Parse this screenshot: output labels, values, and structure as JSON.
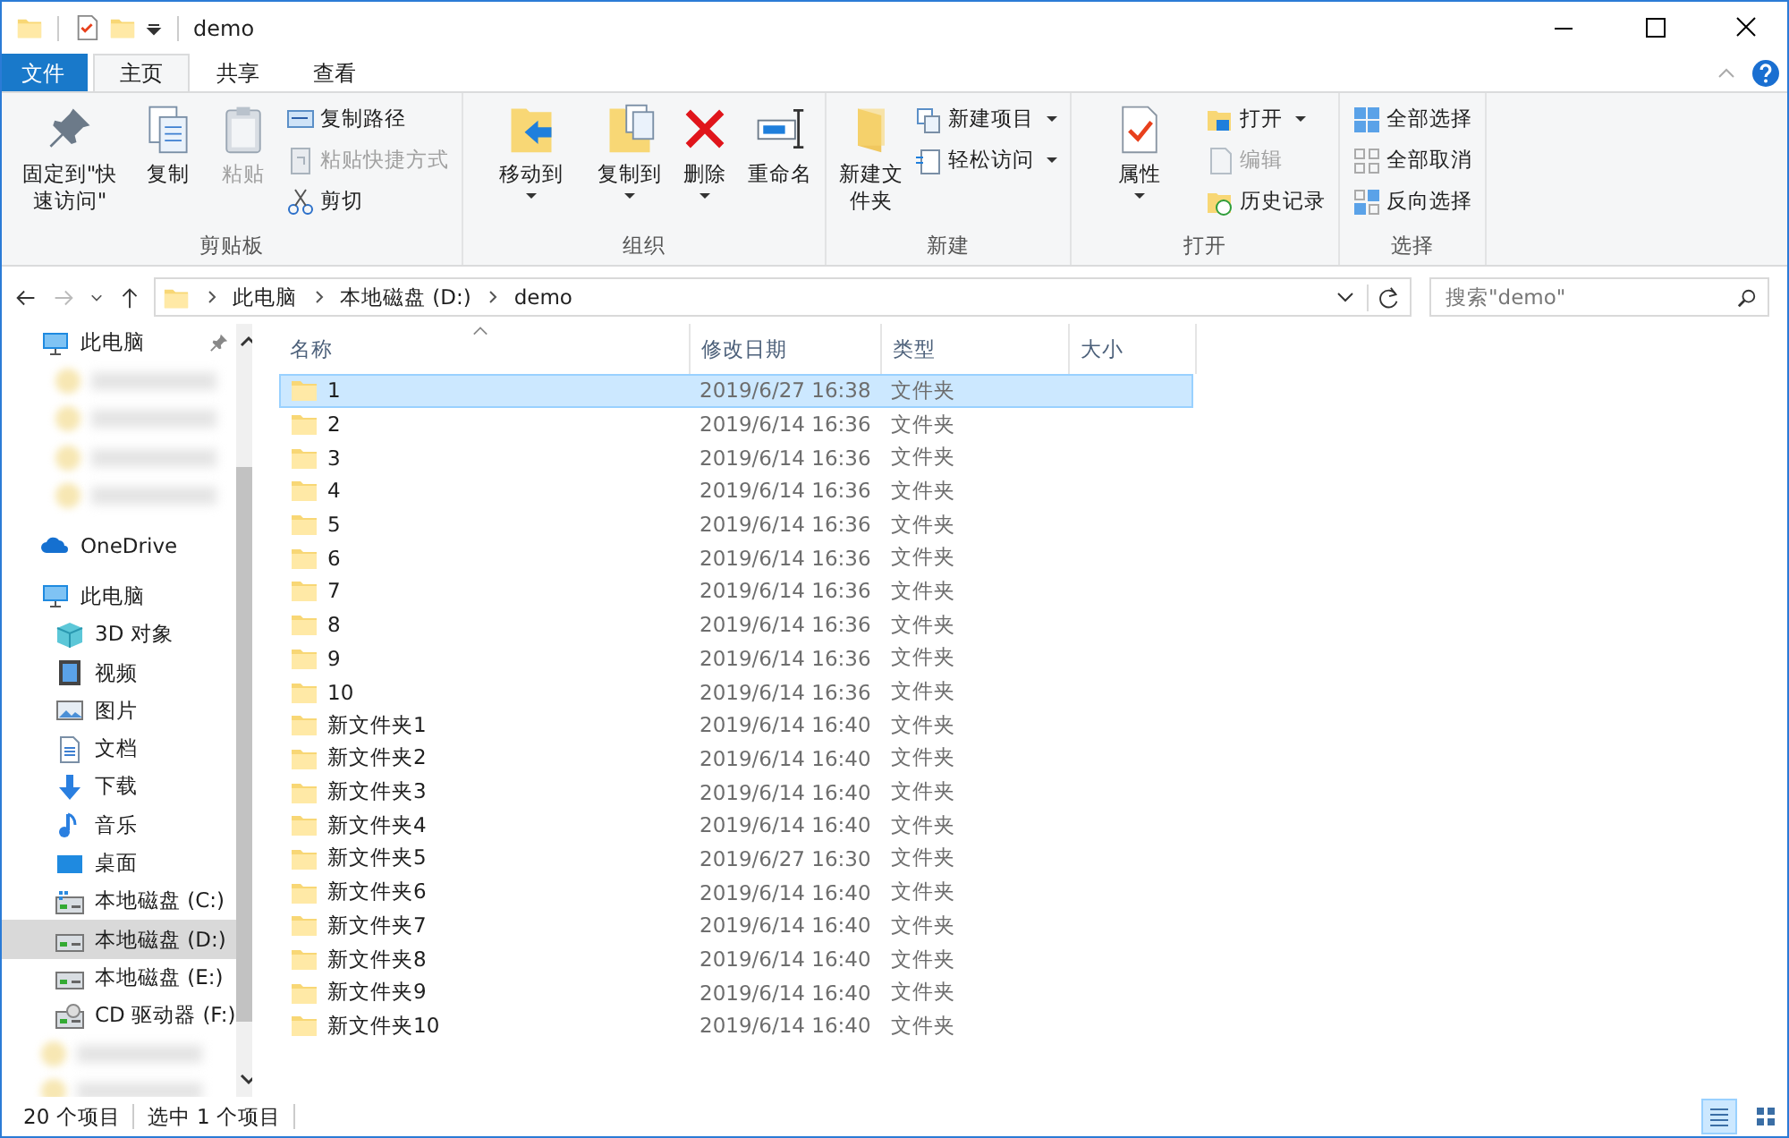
{
  "window": {
    "title": "demo"
  },
  "ribbon_tabs": [
    {
      "label": "文件",
      "kind": "file",
      "selected": false
    },
    {
      "label": "主页",
      "kind": "tab",
      "selected": true
    },
    {
      "label": "共享",
      "kind": "tab",
      "selected": false
    },
    {
      "label": "查看",
      "kind": "tab",
      "selected": false
    }
  ],
  "ribbon_groups": [
    {
      "label": "剪贴板",
      "items": [
        {
          "label": "固定到\"快速访问\"",
          "kind": "large",
          "disabled": false,
          "dropdown": false
        },
        {
          "label": "复制",
          "kind": "large",
          "disabled": false,
          "dropdown": false
        },
        {
          "label": "粘贴",
          "kind": "large",
          "disabled": true,
          "dropdown": false
        },
        {
          "label": "复制路径",
          "kind": "small",
          "disabled": false,
          "dropdown": false
        },
        {
          "label": "粘贴快捷方式",
          "kind": "small",
          "disabled": true,
          "dropdown": false
        },
        {
          "label": "剪切",
          "kind": "small",
          "disabled": false,
          "dropdown": false
        }
      ]
    },
    {
      "label": "组织",
      "items": [
        {
          "label": "移动到",
          "kind": "large",
          "disabled": false,
          "dropdown": true
        },
        {
          "label": "复制到",
          "kind": "large",
          "disabled": false,
          "dropdown": true
        },
        {
          "label": "删除",
          "kind": "large",
          "disabled": false,
          "dropdown": true
        },
        {
          "label": "重命名",
          "kind": "large",
          "disabled": false,
          "dropdown": false
        }
      ]
    },
    {
      "label": "新建",
      "items": [
        {
          "label": "新建文件夹",
          "kind": "large",
          "disabled": false,
          "dropdown": false
        },
        {
          "label": "新建项目",
          "kind": "small",
          "disabled": false,
          "dropdown": true
        },
        {
          "label": "轻松访问",
          "kind": "small",
          "disabled": false,
          "dropdown": true
        }
      ]
    },
    {
      "label": "打开",
      "items": [
        {
          "label": "属性",
          "kind": "large",
          "disabled": false,
          "dropdown": true
        },
        {
          "label": "打开",
          "kind": "small",
          "disabled": false,
          "dropdown": true
        },
        {
          "label": "编辑",
          "kind": "small",
          "disabled": true,
          "dropdown": false
        },
        {
          "label": "历史记录",
          "kind": "small",
          "disabled": false,
          "dropdown": false
        }
      ]
    },
    {
      "label": "选择",
      "items": [
        {
          "label": "全部选择",
          "kind": "small",
          "disabled": false,
          "dropdown": false
        },
        {
          "label": "全部取消",
          "kind": "small",
          "disabled": false,
          "dropdown": false
        },
        {
          "label": "反向选择",
          "kind": "small",
          "disabled": false,
          "dropdown": false
        }
      ]
    }
  ],
  "address": {
    "crumbs": [
      "此电脑",
      "本地磁盘 (D:)",
      "demo"
    ],
    "search_placeholder": "搜索\"demo\""
  },
  "navigation": [
    {
      "label": "此电脑",
      "kind": "item",
      "selected": false,
      "pinned": true,
      "children": [
        {
          "kind": "blurred",
          "selected": false
        },
        {
          "kind": "blurred",
          "selected": false
        },
        {
          "kind": "blurred",
          "selected": false
        },
        {
          "kind": "blurred",
          "selected": false
        }
      ]
    },
    {
      "label": "OneDrive",
      "kind": "item",
      "selected": false,
      "pinned": false
    },
    {
      "label": "此电脑",
      "kind": "item",
      "selected": false,
      "pinned": false,
      "children": [
        {
          "label": "3D 对象",
          "kind": "item",
          "selected": false
        },
        {
          "label": "视频",
          "kind": "item",
          "selected": false
        },
        {
          "label": "图片",
          "kind": "item",
          "selected": false
        },
        {
          "label": "文档",
          "kind": "item",
          "selected": false
        },
        {
          "label": "下载",
          "kind": "item",
          "selected": false
        },
        {
          "label": "音乐",
          "kind": "item",
          "selected": false
        },
        {
          "label": "桌面",
          "kind": "item",
          "selected": false
        },
        {
          "label": "本地磁盘 (C:)",
          "kind": "item",
          "selected": false
        },
        {
          "label": "本地磁盘 (D:)",
          "kind": "item",
          "selected": true
        },
        {
          "label": "本地磁盘 (E:)",
          "kind": "item",
          "selected": false
        },
        {
          "label": "CD 驱动器 (F:)",
          "kind": "item",
          "selected": false
        }
      ]
    },
    {
      "kind": "blurred",
      "selected": false
    },
    {
      "kind": "blurred",
      "selected": false
    }
  ],
  "table": {
    "columns": [
      "名称",
      "修改日期",
      "类型",
      "大小"
    ],
    "rows": [
      {
        "name": "1",
        "modified": "2019/6/27 16:38",
        "type": "文件夹",
        "selected": true
      },
      {
        "name": "2",
        "modified": "2019/6/14 16:36",
        "type": "文件夹",
        "selected": false
      },
      {
        "name": "3",
        "modified": "2019/6/14 16:36",
        "type": "文件夹",
        "selected": false
      },
      {
        "name": "4",
        "modified": "2019/6/14 16:36",
        "type": "文件夹",
        "selected": false
      },
      {
        "name": "5",
        "modified": "2019/6/14 16:36",
        "type": "文件夹",
        "selected": false
      },
      {
        "name": "6",
        "modified": "2019/6/14 16:36",
        "type": "文件夹",
        "selected": false
      },
      {
        "name": "7",
        "modified": "2019/6/14 16:36",
        "type": "文件夹",
        "selected": false
      },
      {
        "name": "8",
        "modified": "2019/6/14 16:36",
        "type": "文件夹",
        "selected": false
      },
      {
        "name": "9",
        "modified": "2019/6/14 16:36",
        "type": "文件夹",
        "selected": false
      },
      {
        "name": "10",
        "modified": "2019/6/14 16:36",
        "type": "文件夹",
        "selected": false
      },
      {
        "name": "新文件夹1",
        "modified": "2019/6/14 16:40",
        "type": "文件夹",
        "selected": false
      },
      {
        "name": "新文件夹2",
        "modified": "2019/6/14 16:40",
        "type": "文件夹",
        "selected": false
      },
      {
        "name": "新文件夹3",
        "modified": "2019/6/14 16:40",
        "type": "文件夹",
        "selected": false
      },
      {
        "name": "新文件夹4",
        "modified": "2019/6/14 16:40",
        "type": "文件夹",
        "selected": false
      },
      {
        "name": "新文件夹5",
        "modified": "2019/6/27 16:30",
        "type": "文件夹",
        "selected": false
      },
      {
        "name": "新文件夹6",
        "modified": "2019/6/14 16:40",
        "type": "文件夹",
        "selected": false
      },
      {
        "name": "新文件夹7",
        "modified": "2019/6/14 16:40",
        "type": "文件夹",
        "selected": false
      },
      {
        "name": "新文件夹8",
        "modified": "2019/6/14 16:40",
        "type": "文件夹",
        "selected": false
      },
      {
        "name": "新文件夹9",
        "modified": "2019/6/14 16:40",
        "type": "文件夹",
        "selected": false
      },
      {
        "name": "新文件夹10",
        "modified": "2019/6/14 16:40",
        "type": "文件夹",
        "selected": false
      }
    ]
  },
  "status_bar": {
    "count": "20 个项目",
    "selection": "选中 1 个项目"
  },
  "view_buttons": [
    {
      "selected": true
    },
    {
      "selected": false
    }
  ]
}
